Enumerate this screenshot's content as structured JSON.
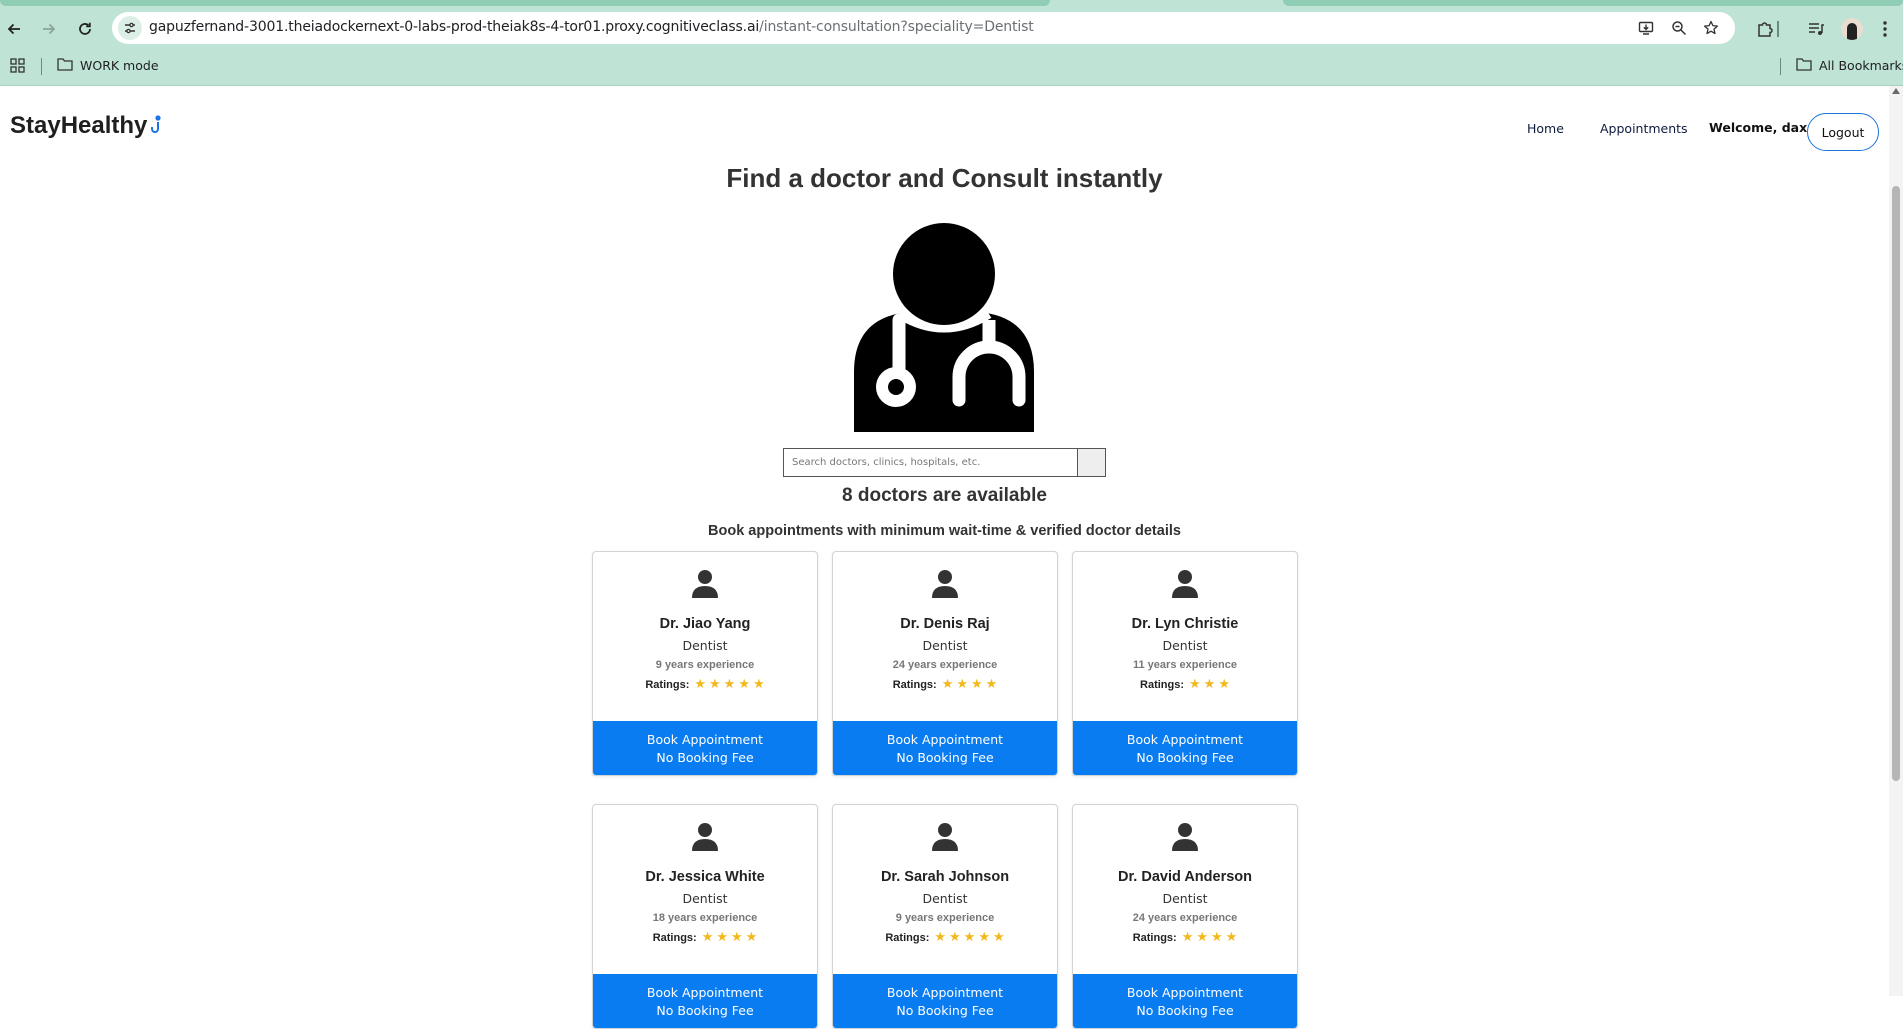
{
  "browser": {
    "url_host": "gapuzfernand-3001.theiadockernext-0-labs-prod-theiak8s-4-tor01.proxy.cognitiveclass.ai",
    "url_path": "/instant-consultation?speciality=Dentist",
    "bookmarks": {
      "folder": "WORK mode",
      "all": "All Bookmarks"
    },
    "icons": {
      "back": "arrow-left-icon",
      "forward": "arrow-right-icon",
      "reload": "reload-icon",
      "apps": "apps-grid-icon",
      "folder": "folder-icon",
      "install": "install-app-icon",
      "zoom": "zoom-icon",
      "bookmark": "star-icon",
      "extensions": "puzzle-icon",
      "media": "media-controls-icon",
      "profile": "profile-avatar",
      "menu": "kebab-menu-icon"
    },
    "colors": {
      "chrome": "#bfe3d4",
      "omnibox": "#ffffff"
    }
  },
  "navbar": {
    "brand": "StayHealthy",
    "links": [
      "Home",
      "Appointments"
    ],
    "welcome": "Welcome, dax",
    "logout": "Logout"
  },
  "main": {
    "headline": "Find a doctor and Consult instantly",
    "search_placeholder": "Search doctors, clinics, hospitals, etc.",
    "count": "8 doctors are available",
    "subtitle": "Book appointments with minimum wait-time & verified doctor details"
  },
  "rating_label": "Ratings:",
  "book_label": "Book Appointment",
  "fee_label": "No Booking Fee",
  "doctors": [
    {
      "name": "Dr. Jiao Yang",
      "speciality": "Dentist",
      "experience": "9 years experience",
      "rating": 5
    },
    {
      "name": "Dr. Denis Raj",
      "speciality": "Dentist",
      "experience": "24 years experience",
      "rating": 4
    },
    {
      "name": "Dr. Lyn Christie",
      "speciality": "Dentist",
      "experience": "11 years experience",
      "rating": 3
    },
    {
      "name": "Dr. Jessica White",
      "speciality": "Dentist",
      "experience": "18 years experience",
      "rating": 4
    },
    {
      "name": "Dr. Sarah Johnson",
      "speciality": "Dentist",
      "experience": "9 years experience",
      "rating": 5
    },
    {
      "name": "Dr. David Anderson",
      "speciality": "Dentist",
      "experience": "24 years experience",
      "rating": 4
    }
  ],
  "colors": {
    "primary_button": "#0a7cf2",
    "logout_border": "#1e73d8",
    "star": "#f2b81c"
  }
}
